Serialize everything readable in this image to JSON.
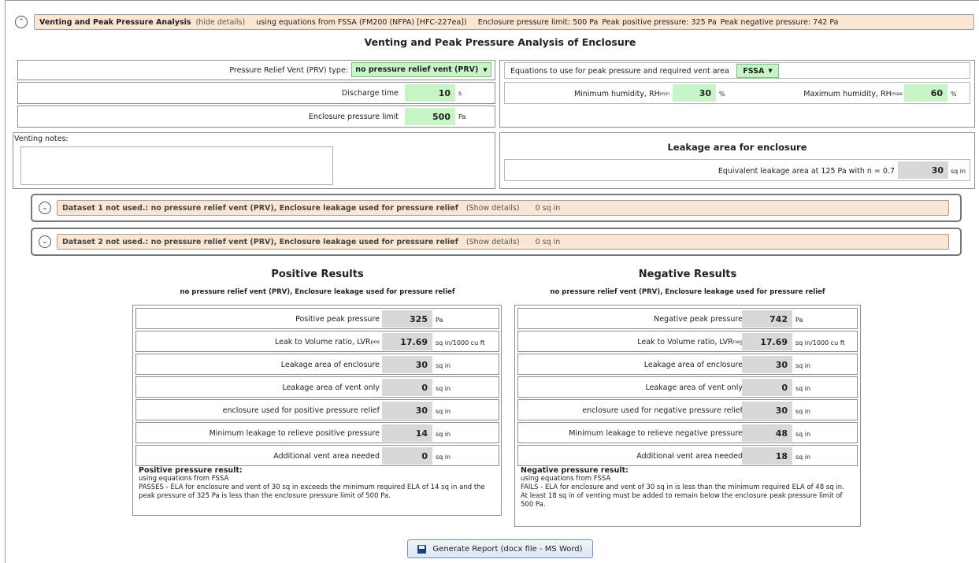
{
  "header": {
    "title": "Venting and Peak Pressure Analysis",
    "toggle": "(hide details)",
    "summary": "using equations from FSSA (FM200 (NFPA) [HFC-227ea])",
    "pressure_limit": "Enclosure pressure limit: 500 Pa",
    "peak_positive": "Peak positive pressure: 325 Pa",
    "peak_negative": "Peak negative pressure: 742 Pa"
  },
  "section_title": "Venting and Peak Pressure Analysis of Enclosure",
  "inputs": {
    "prv_label": "Pressure Relief Vent (PRV) type:",
    "prv_value": "no pressure relief vent (PRV)",
    "discharge_label": "Discharge time",
    "discharge_value": "10",
    "discharge_unit": "s",
    "limit_label": "Enclosure pressure limit",
    "limit_value": "500",
    "limit_unit": "Pa",
    "equations_label": "Equations to use for peak pressure and required vent area",
    "equations_value": "FSSA",
    "rhmin_label": "Minimum humidity, RH",
    "rhmin_sub": "min",
    "rhmin_value": "30",
    "rhmin_unit": "%",
    "rhmax_label": "Maximum humidity, RH",
    "rhmax_sub": "max",
    "rhmax_value": "60",
    "rhmax_unit": "%"
  },
  "notes": {
    "label": "Venting notes:",
    "value": ""
  },
  "leakage": {
    "title": "Leakage area for enclosure",
    "label": "Equivalent leakage area at 125 Pa with n = 0.7",
    "value": "30",
    "unit": "sq in"
  },
  "datasets": [
    {
      "title": "Dataset 1 not used.: no pressure relief vent (PRV), Enclosure leakage used for pressure relief",
      "toggle": "(Show details)",
      "value": "0 sq in"
    },
    {
      "title": "Dataset 2 not used.: no pressure relief vent (PRV), Enclosure leakage used for pressure relief",
      "toggle": "(Show details)",
      "value": "0 sq in"
    }
  ],
  "positive": {
    "title": "Positive Results",
    "subtitle": "no pressure relief vent (PRV), Enclosure leakage used for pressure relief",
    "rows": [
      {
        "label": "Positive peak pressure",
        "sub": "",
        "value": "325",
        "unit": "Pa"
      },
      {
        "label": "Leak to Volume ratio, LVR",
        "sub": "pos",
        "value": "17.69",
        "unit": "sq in/1000 cu ft"
      },
      {
        "label": "Leakage area of enclosure",
        "sub": "",
        "value": "30",
        "unit": "sq in"
      },
      {
        "label": "Leakage area of vent only",
        "sub": "",
        "value": "0",
        "unit": "sq in"
      },
      {
        "label": "enclosure  used for positive pressure relief",
        "sub": "",
        "value": "30",
        "unit": "sq in"
      },
      {
        "label": "Minimum leakage to relieve positive pressure",
        "sub": "",
        "value": "14",
        "unit": "sq in"
      },
      {
        "label": "Additional vent area needed",
        "sub": "",
        "value": "0",
        "unit": "sq in"
      }
    ],
    "result_title": "Positive pressure result:",
    "result_line1": "using equations from FSSA",
    "result_text": "PASSES - ELA for enclosure and vent  of 30 sq in exceeds the minimum required ELA of 14 sq in and the peak pressure of 325 Pa is less than the enclosure pressure limit of 500 Pa."
  },
  "negative": {
    "title": "Negative Results",
    "subtitle": "no pressure relief vent (PRV), Enclosure leakage used for pressure relief",
    "rows": [
      {
        "label": "Negative peak pressure",
        "sub": "",
        "value": "742",
        "unit": "Pa"
      },
      {
        "label": "Leak to Volume ratio, LVR",
        "sub": "neg",
        "value": "17.69",
        "unit": "sq in/1000 cu ft"
      },
      {
        "label": "Leakage area of enclosure",
        "sub": "",
        "value": "30",
        "unit": "sq in"
      },
      {
        "label": "Leakage area of vent only",
        "sub": "",
        "value": "0",
        "unit": "sq in"
      },
      {
        "label": "enclosure  used for negative pressure relief",
        "sub": "",
        "value": "30",
        "unit": "sq in"
      },
      {
        "label": "Minimum leakage to relieve negative pressure",
        "sub": "",
        "value": "48",
        "unit": "sq in"
      },
      {
        "label": "Additional vent area needed",
        "sub": "",
        "value": "18",
        "unit": "sq in"
      }
    ],
    "result_title": "Negative pressure result:",
    "result_line1": "using equations from FSSA",
    "result_text": "FAILS - ELA for enclosure and vent  of 30 sq in is less than the minimum required ELA of 48 sq in.  At least 18 sq in of venting must be added to remain below the enclosure peak pressure limit of 500 Pa."
  },
  "button": {
    "label": "Generate Report (docx file - MS Word)",
    "icon": "save-icon"
  }
}
